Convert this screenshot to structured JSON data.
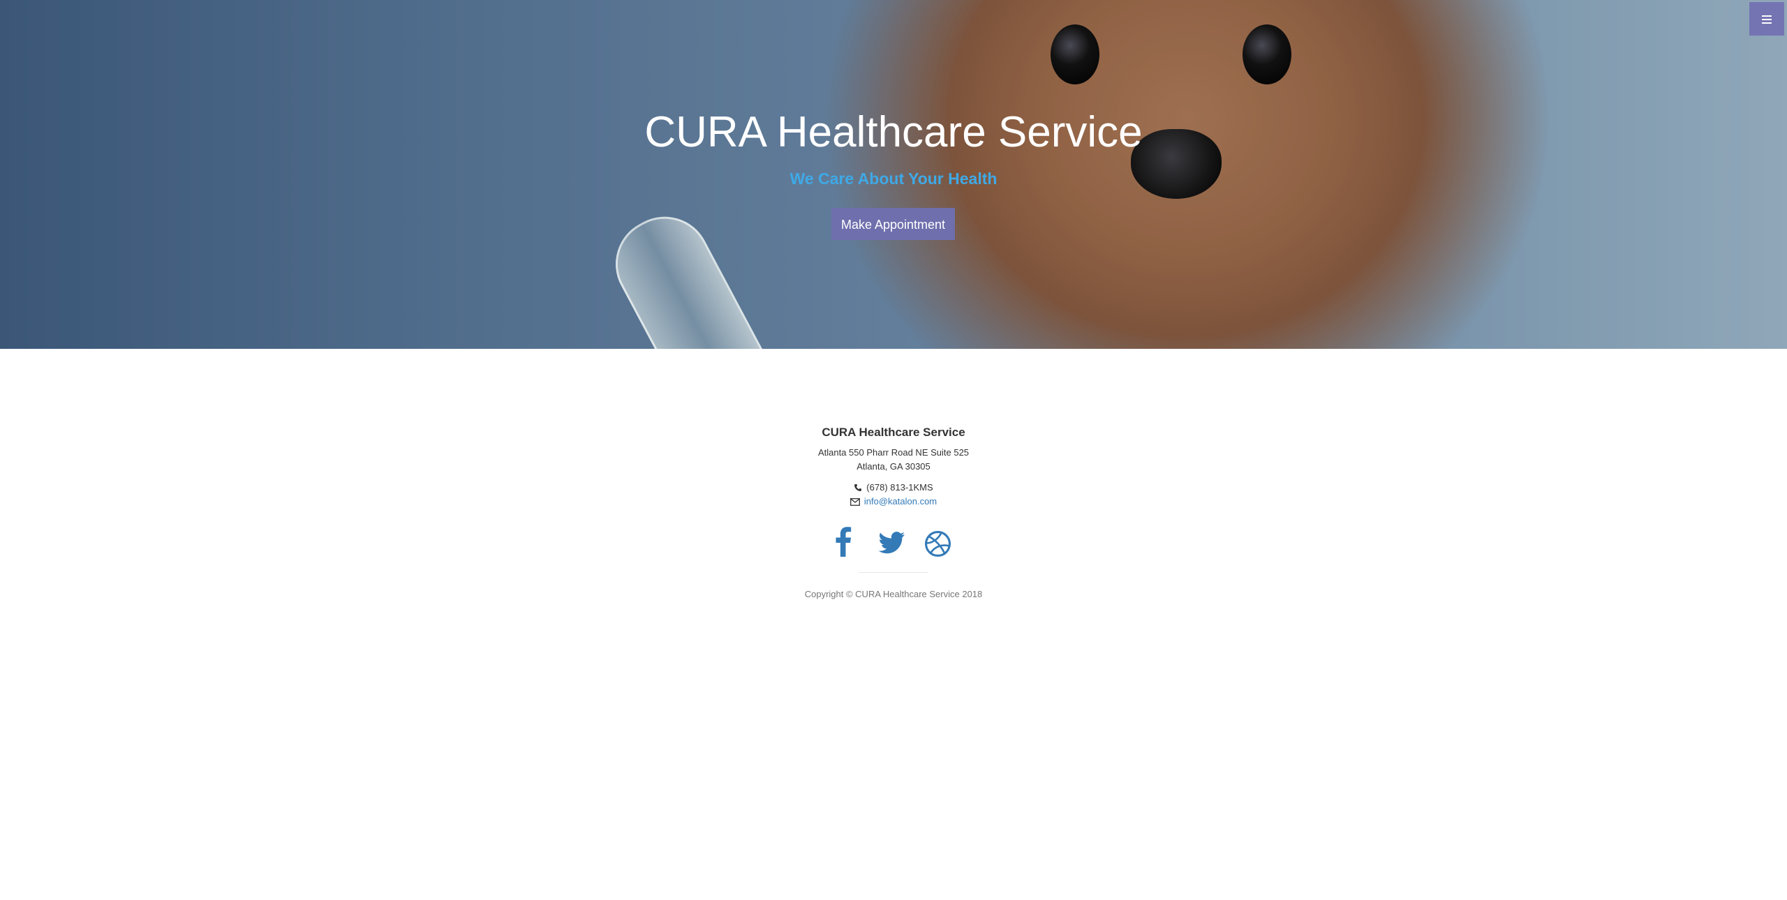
{
  "hero": {
    "title": "CURA Healthcare Service",
    "subtitle": "We Care About Your Health",
    "button_label": "Make Appointment",
    "accent_color": "#3fa9e6",
    "button_color": "#6f6fae"
  },
  "menu": {
    "icon": "hamburger-menu-icon",
    "color": "#7474b3"
  },
  "footer": {
    "title": "CURA Healthcare Service",
    "address_line1": "Atlanta 550 Pharr Road NE Suite 525",
    "address_line2": "Atlanta, GA 30305",
    "phone": "(678) 813-1KMS",
    "phone_icon": "phone-icon",
    "email": "info@katalon.com",
    "email_icon": "envelope-icon",
    "social": [
      {
        "icon": "facebook-icon"
      },
      {
        "icon": "twitter-icon"
      },
      {
        "icon": "dribbble-icon"
      }
    ],
    "copyright": "Copyright © CURA Healthcare Service 2018",
    "link_color": "#337ab7"
  }
}
